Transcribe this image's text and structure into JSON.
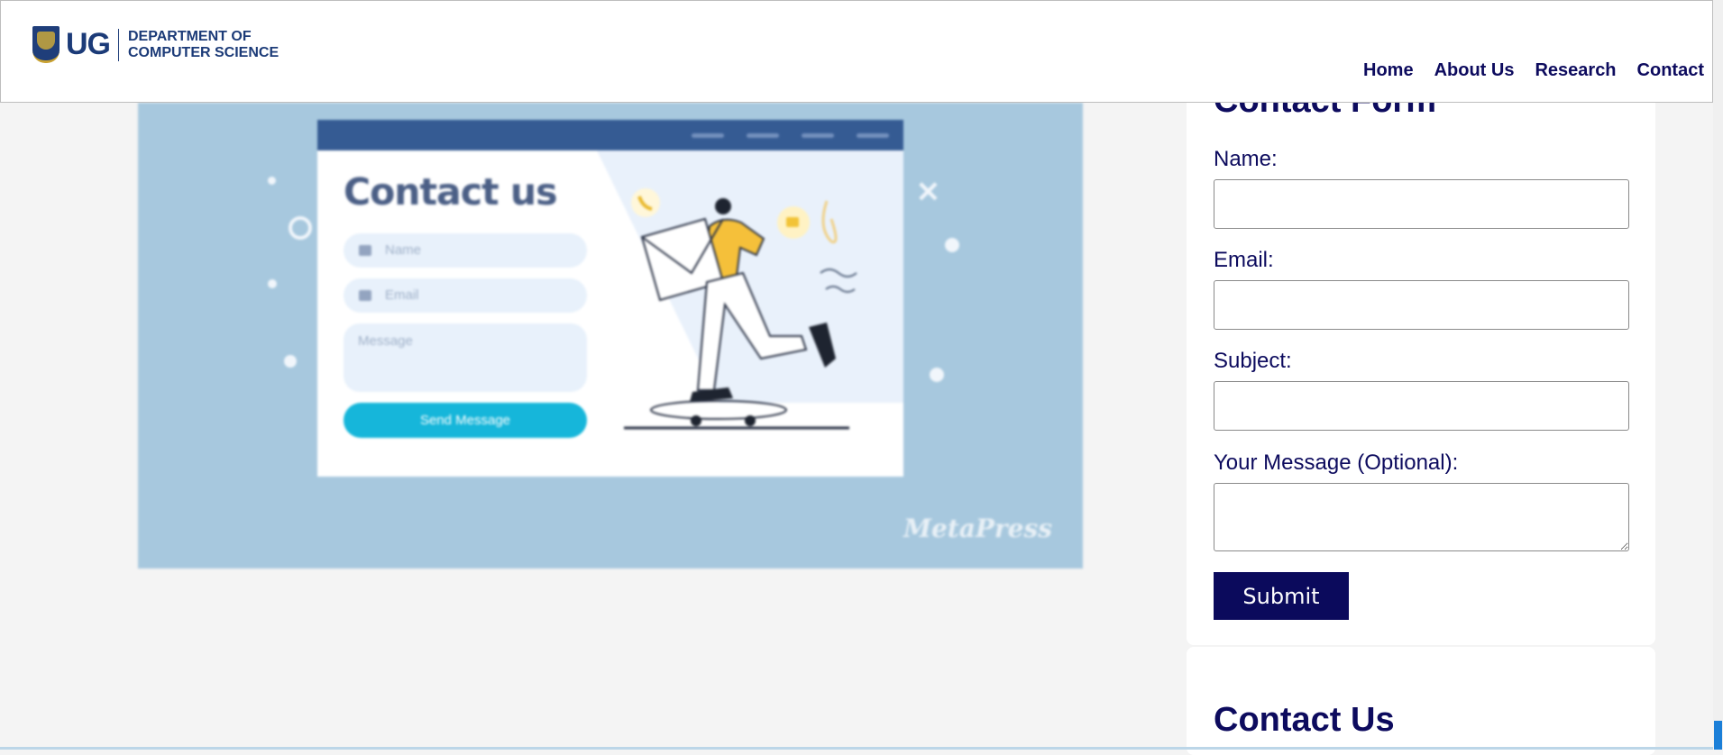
{
  "header": {
    "logo_main": "UG",
    "logo_line1": "DEPARTMENT OF",
    "logo_line2": "COMPUTER SCIENCE"
  },
  "nav": {
    "items": [
      "Home",
      "About Us",
      "Research",
      "Contact"
    ]
  },
  "hero_image": {
    "mock_title": "Contact us",
    "name_placeholder": "Name",
    "email_placeholder": "Email",
    "message_placeholder": "Message",
    "send_label": "Send Message",
    "watermark": "MetaPress"
  },
  "form": {
    "title": "Contact Form",
    "name_label": "Name:",
    "email_label": "Email:",
    "subject_label": "Subject:",
    "message_label": "Your Message (Optional):",
    "name_value": "",
    "email_value": "",
    "subject_value": "",
    "message_value": "",
    "submit_label": "Submit"
  },
  "contact_section": {
    "title": "Contact Us"
  },
  "colors": {
    "primary": "#0d0b5e",
    "hero_bg": "#a7c8de",
    "send_button": "#16b6da",
    "scrollbar_thumb": "#1b7fd8"
  }
}
